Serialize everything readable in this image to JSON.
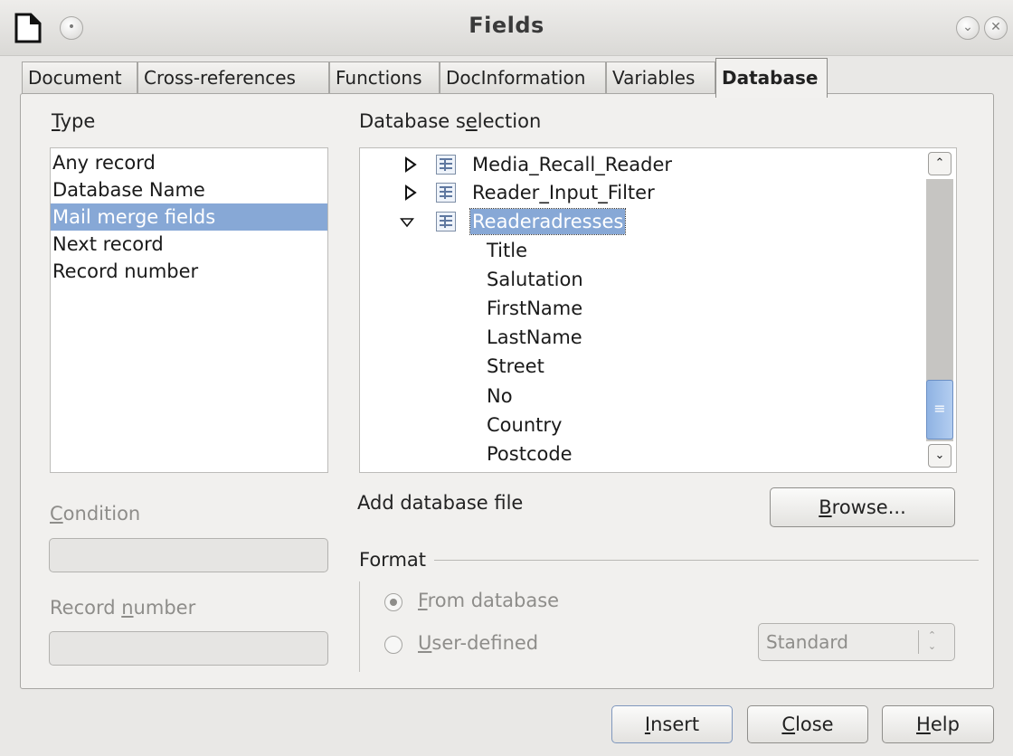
{
  "window": {
    "title": "Fields"
  },
  "tabs": [
    {
      "label": "Document"
    },
    {
      "label": "Cross-references"
    },
    {
      "label": "Functions"
    },
    {
      "label": "DocInformation"
    },
    {
      "label": "Variables"
    },
    {
      "label": "Database",
      "active": true
    }
  ],
  "type_section": {
    "label_first": "T",
    "label_rest": "ype",
    "items": [
      "Any record",
      "Database Name",
      "Mail merge fields",
      "Next record",
      "Record number"
    ],
    "selected": "Mail merge fields"
  },
  "database_selection": {
    "label_pre": "Database s",
    "label_u": "e",
    "label_post": "lection",
    "tree": [
      {
        "label": "Media_Recall_Reader",
        "expanded": false
      },
      {
        "label": "Reader_Input_Filter",
        "expanded": false
      },
      {
        "label": "Readeradresses",
        "expanded": true,
        "selected": true,
        "children": [
          "Title",
          "Salutation",
          "FirstName",
          "LastName",
          "Street",
          "No",
          "Country",
          "Postcode"
        ]
      }
    ]
  },
  "condition": {
    "label_u": "C",
    "label_rest": "ondition",
    "value": ""
  },
  "record_number": {
    "label_pre": "Record ",
    "label_u": "n",
    "label_post": "umber",
    "value": ""
  },
  "add_database": {
    "label": "Add database file",
    "browse_u": "B",
    "browse_rest": "rowse..."
  },
  "format": {
    "label": "Format",
    "options": [
      {
        "u": "F",
        "rest": "rom database",
        "checked": true
      },
      {
        "u": "U",
        "rest": "ser-defined",
        "checked": false
      }
    ],
    "select_value": "Standard"
  },
  "buttons": {
    "insert_u": "I",
    "insert_rest": "nsert",
    "close_u": "C",
    "close_rest": "lose",
    "help_u": "H",
    "help_rest": "elp"
  },
  "colors": {
    "selection": "#87a8d6",
    "disabled_text": "#8e8d8a"
  }
}
